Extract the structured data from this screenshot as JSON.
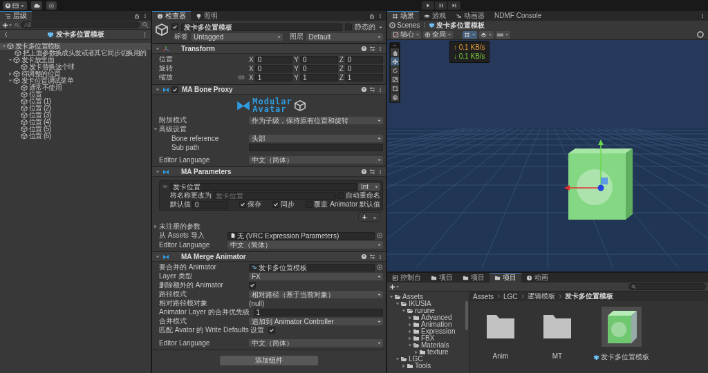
{
  "hierarchy": {
    "tab": "层级",
    "search": {
      "placeholder": "All"
    },
    "scene_title": "发卡多位置模板",
    "tree": [
      {
        "label": "发卡多位置模板",
        "selected": true,
        "expanded": true,
        "children": [
          {
            "label": "把上面参数换成头发或者其它同步切换用的",
            "selected": false
          },
          {
            "label": "发卡放里面",
            "selected": false,
            "expanded": true,
            "children": [
              {
                "label": "发卡替换这个球",
                "selected": false
              }
            ]
          },
          {
            "label": "待调整的位置",
            "selected": false,
            "expanded": false
          },
          {
            "label": "发卡位置调试菜单",
            "selected": false,
            "expanded": true,
            "children": [
              {
                "label": "通常不使用",
                "selected": false
              },
              {
                "label": "位置",
                "selected": false
              },
              {
                "label": "位置 (1)",
                "selected": false
              },
              {
                "label": "位置 (2)",
                "selected": false
              },
              {
                "label": "位置 (3)",
                "selected": false
              },
              {
                "label": "位置 (4)",
                "selected": false
              },
              {
                "label": "位置 (5)",
                "selected": false
              },
              {
                "label": "位置 (6)",
                "selected": false
              }
            ]
          }
        ]
      }
    ]
  },
  "inspector": {
    "tabs": [
      {
        "label": "检查器",
        "kind": "inspector",
        "selected": true
      },
      {
        "label": "照明",
        "kind": "lighting",
        "selected": false
      }
    ],
    "object": {
      "active": true,
      "name": "发卡多位置模板",
      "static_label": "静态的",
      "static": false,
      "tag_label": "标签",
      "tag": "Untagged",
      "layer_label": "图层",
      "layer": "Default"
    },
    "components": [
      {
        "kind": "transform",
        "title": "Transform",
        "expanded": true,
        "rows": [
          {
            "label": "位置",
            "constrain_toggle": false,
            "values": [
              {
                "axis": "X",
                "value": "0"
              },
              {
                "axis": "Y",
                "value": "0"
              },
              {
                "axis": "Z",
                "value": "0"
              }
            ]
          },
          {
            "label": "旋转",
            "constrain_toggle": false,
            "values": [
              {
                "axis": "X",
                "value": "0"
              },
              {
                "axis": "Y",
                "value": "0"
              },
              {
                "axis": "Z",
                "value": "0"
              }
            ]
          },
          {
            "label": "缩放",
            "constrain_toggle": true,
            "values": [
              {
                "axis": "X",
                "value": "1"
              },
              {
                "axis": "Y",
                "value": "1"
              },
              {
                "axis": "Z",
                "value": "1"
              }
            ]
          }
        ]
      },
      {
        "kind": "bone_proxy",
        "title": "MA Bone Proxy",
        "expanded": true,
        "enabled": true,
        "logo": [
          "Modular",
          "Avatar"
        ],
        "rows": [
          {
            "kind": "dropdown",
            "label": "附加模式",
            "value": "作为子级，保持原有位置和旋转"
          },
          {
            "kind": "foldout",
            "label": "高级设置",
            "expanded": true,
            "children": [
              {
                "kind": "dropdown",
                "label": "Bone reference",
                "value": "头部"
              },
              {
                "kind": "field",
                "label": "Sub path"
              }
            ]
          },
          {
            "kind": "dropdown",
            "label": "Editor Language",
            "value": "中文（简体）"
          }
        ]
      },
      {
        "kind": "parameters",
        "title": "MA Parameters",
        "expanded": true,
        "entries": [
          {
            "name": "发卡位置",
            "type": "Int",
            "rename_label": "将名称更改为",
            "rename_placeholder": "发卡位置",
            "auto_rename_label": "自动重命名",
            "auto_rename": false,
            "default_label": "默认值",
            "default": "0",
            "saved_label": "保存",
            "saved": true,
            "synced_label": "同步",
            "synced": true,
            "override_label": "覆盖 Animator 默认值",
            "override": false
          }
        ],
        "add_button": "+",
        "remove_button": "-",
        "rows": [
          {
            "kind": "foldout",
            "label": "未注册的参数",
            "expanded": false
          },
          {
            "kind": "file_object",
            "label": "从 Assets 导入",
            "value": "无 (VRC Expression Parameters)"
          },
          {
            "kind": "dropdown",
            "label": "Editor Language",
            "value": "中文（简体）"
          }
        ]
      },
      {
        "kind": "merge_animator",
        "title": "MA Merge Animator",
        "expanded": true,
        "rows": [
          {
            "kind": "controller_object",
            "label": "要合并的 Animator",
            "value": "发卡多位置模板"
          },
          {
            "kind": "dropdown",
            "label": "Layer 类型",
            "value": "FX"
          },
          {
            "kind": "checkbox",
            "label": "删除额外的 Animator",
            "checked": true
          },
          {
            "kind": "dropdown",
            "label": "路径模式",
            "value": "相对路径（基于当前对象）"
          },
          {
            "kind": "text",
            "label": "相对路径根对象",
            "value": "(null)"
          },
          {
            "kind": "field",
            "label": "Animator Layer 的合并优先级",
            "value": "1"
          },
          {
            "kind": "dropdown",
            "label": "合并模式",
            "value": "追加到 Animator Controller"
          },
          {
            "kind": "checkbox",
            "label": "匹配 Avatar 的 Write Defaults 设置",
            "checked": true
          },
          {
            "kind": "dropdown",
            "label": "Editor Language",
            "value": "中文（简体）"
          }
        ]
      }
    ],
    "add_component": "添加组件"
  },
  "scene": {
    "tabs": [
      {
        "label": "场景",
        "kind": "scene",
        "selected": true
      },
      {
        "label": "游戏",
        "kind": "game",
        "selected": false
      },
      {
        "label": "动画器",
        "kind": "animator",
        "selected": false
      },
      {
        "label": "NDMF Console",
        "kind": "plain",
        "selected": false
      }
    ],
    "breadcrumb": [
      {
        "label": "Scenes",
        "kind": "scene"
      },
      {
        "label": "发卡多位置模板",
        "kind": "prefab"
      }
    ],
    "toolbar": [
      {
        "label": "轴心",
        "kind": "pivot"
      },
      {
        "label": "全局",
        "kind": "global"
      }
    ],
    "tools": [
      {
        "kind": "hand",
        "selected": false
      },
      {
        "kind": "move",
        "selected": true
      },
      {
        "kind": "rotate",
        "selected": false
      },
      {
        "kind": "scale",
        "selected": false
      },
      {
        "kind": "rect",
        "selected": false
      },
      {
        "kind": "transform",
        "selected": false
      }
    ],
    "network_overlay": {
      "upload": "↑ 0.1 KB/s",
      "download": "↓ 0.1 KB/s"
    }
  },
  "project": {
    "tabs": [
      {
        "label": "控制台",
        "kind": "console",
        "selected": false
      },
      {
        "label": "项目",
        "kind": "project",
        "selected": false
      },
      {
        "label": "项目",
        "kind": "project",
        "selected": false
      },
      {
        "label": "项目",
        "kind": "project",
        "selected": true
      },
      {
        "label": "动画",
        "kind": "animation",
        "selected": false
      }
    ],
    "folders": [
      {
        "label": "Assets",
        "expanded": true,
        "children": [
          {
            "label": "IKUSIA",
            "expanded": true,
            "children": [
              {
                "label": "rurune",
                "expanded": true,
                "children": [
                  {
                    "label": "Advanced",
                    "expanded": false
                  },
                  {
                    "label": "Animation",
                    "expanded": false
                  },
                  {
                    "label": "Expression",
                    "expanded": false
                  },
                  {
                    "label": "FBX",
                    "expanded": false
                  },
                  {
                    "label": "Materials",
                    "expanded": true,
                    "children": [
                      {
                        "label": "texture",
                        "expanded": false
                      }
                    ]
                  }
                ]
              }
            ]
          },
          {
            "label": "LGC",
            "expanded": true,
            "children": [
              {
                "label": "Tools",
                "expanded": false
              }
            ]
          }
        ]
      }
    ],
    "path": [
      "Assets",
      "LGC",
      "逻辑模板",
      "发卡多位置模板"
    ],
    "assets": [
      {
        "label": "Anim",
        "kind": "folder",
        "selected": false
      },
      {
        "label": "MT",
        "kind": "folder",
        "selected": false
      },
      {
        "label": "发卡多位置模板",
        "kind": "prefab",
        "selected": true
      }
    ]
  }
}
